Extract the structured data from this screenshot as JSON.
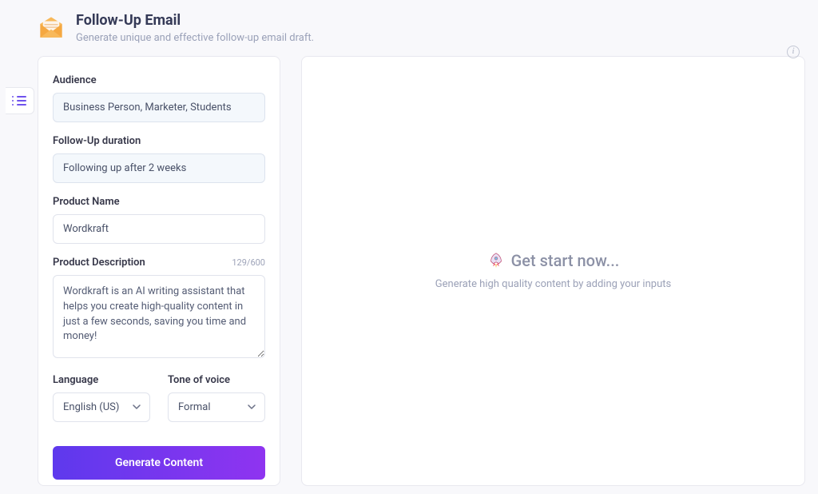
{
  "header": {
    "title": "Follow-Up Email",
    "subtitle": "Generate unique and effective follow-up email draft."
  },
  "form": {
    "audience": {
      "label": "Audience",
      "value": "Business Person, Marketer, Students"
    },
    "followup_duration": {
      "label": "Follow-Up duration",
      "value": "Following up after 2 weeks"
    },
    "product_name": {
      "label": "Product Name",
      "value": "Wordkraft"
    },
    "product_description": {
      "label": "Product Description",
      "counter": "129/600",
      "value": "Wordkraft is an AI writing assistant that helps you create high-quality content in just a few seconds, saving you time and money!"
    },
    "language": {
      "label": "Language",
      "value": "English (US)"
    },
    "tone": {
      "label": "Tone of voice",
      "value": "Formal"
    },
    "generate_label": "Generate Content"
  },
  "output": {
    "title": "Get start now...",
    "subtitle": "Generate high quality content by adding your inputs"
  }
}
